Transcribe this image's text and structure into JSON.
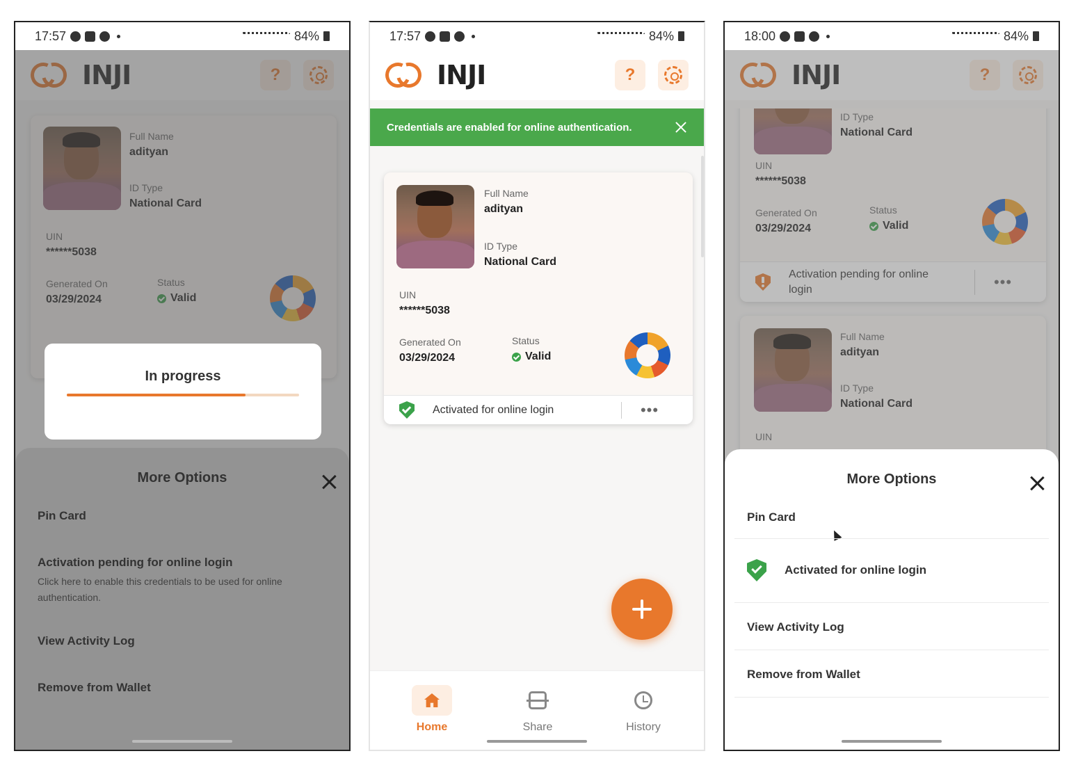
{
  "theme": {
    "accent": "#e8782c",
    "success": "#4aa84b",
    "accent_light": "#fdeee2"
  },
  "brand": {
    "logo_text": "INJI"
  },
  "icons": {
    "help": "?",
    "settings": "gear-icon"
  },
  "labels": {
    "full_name": "Full Name",
    "id_type": "ID Type",
    "uin": "UIN",
    "generated_on": "Generated On",
    "status": "Status"
  },
  "credential": {
    "full_name": "adityan",
    "id_type": "National Card",
    "uin": "******5038",
    "generated_on": "03/29/2024",
    "status": "Valid"
  },
  "screens": [
    {
      "status_time": "17:57",
      "battery": "84%",
      "progress_title": "In progress",
      "progress_fraction": 0.77,
      "sheet": {
        "title": "More Options",
        "pin_card": "Pin Card",
        "activation_title": "Activation pending for online login",
        "activation_subtitle": "Click here to enable this credentials to be used for online authentication.",
        "view_activity": "View Activity Log",
        "remove": "Remove from Wallet"
      }
    },
    {
      "status_time": "17:57",
      "battery": "84%",
      "toast": "Credentials are enabled for online authentication.",
      "card_footer": "Activated for online login",
      "kebab": "•••",
      "nav": [
        {
          "label": "Home",
          "icon": "home-icon",
          "active": true
        },
        {
          "label": "Share",
          "icon": "scan-icon",
          "active": false
        },
        {
          "label": "History",
          "icon": "history-icon",
          "active": false
        }
      ]
    },
    {
      "status_time": "18:00",
      "battery": "84%",
      "card_footer": "Activation pending for online login",
      "kebab": "•••",
      "sheet": {
        "title": "More Options",
        "pin_card": "Pin Card",
        "activated": "Activated for online login",
        "view_activity": "View Activity Log",
        "remove": "Remove from Wallet"
      }
    }
  ]
}
